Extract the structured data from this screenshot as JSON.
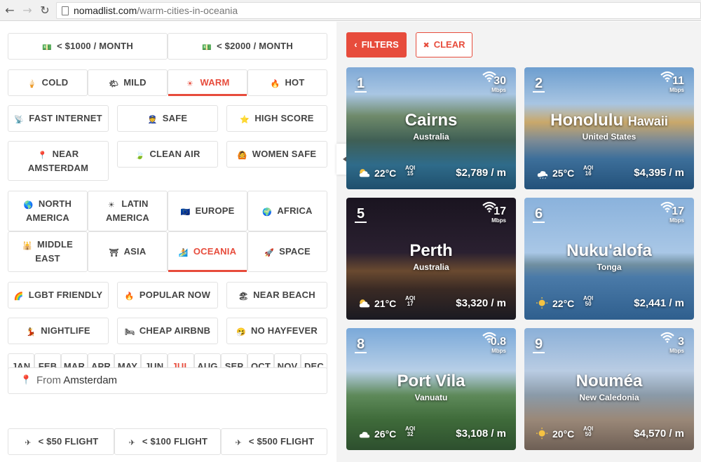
{
  "browser": {
    "domain": "nomadlist.com",
    "path": "/warm-cities-in-oceania",
    "back": "←",
    "forward": "→",
    "reload": "↻"
  },
  "budget": [
    {
      "label": "< $1000 / MONTH",
      "icon": "💵"
    },
    {
      "label": "< $2000 / MONTH",
      "icon": "💵"
    }
  ],
  "climate": [
    {
      "label": "COLD",
      "icon": "🍦"
    },
    {
      "label": "MILD",
      "icon": "🌤"
    },
    {
      "label": "WARM",
      "icon": "☀"
    },
    {
      "label": "HOT",
      "icon": "🔥"
    }
  ],
  "features1": [
    {
      "label": "FAST INTERNET",
      "icon": "📡"
    },
    {
      "label": "SAFE",
      "icon": "👮"
    },
    {
      "label": "HIGH SCORE",
      "icon": "⭐"
    }
  ],
  "features2": [
    {
      "label": "NEAR AMSTERDAM",
      "icon": "📍"
    },
    {
      "label": "CLEAN AIR",
      "icon": "🍃"
    },
    {
      "label": "WOMEN SAFE",
      "icon": "🙆"
    }
  ],
  "regions": [
    {
      "label": "NORTH AMERICA",
      "icon": "🌎"
    },
    {
      "label": "LATIN AMERICA",
      "icon": "☀"
    },
    {
      "label": "EUROPE",
      "icon": "🇪🇺"
    },
    {
      "label": "AFRICA",
      "icon": "🌍"
    },
    {
      "label": "MIDDLE EAST",
      "icon": "🕌"
    },
    {
      "label": "ASIA",
      "icon": "⛩"
    },
    {
      "label": "OCEANIA",
      "icon": "🏄"
    },
    {
      "label": "SPACE",
      "icon": "🚀"
    }
  ],
  "features3": [
    {
      "label": "LGBT FRIENDLY",
      "icon": "🌈"
    },
    {
      "label": "POPULAR NOW",
      "icon": "🔥"
    },
    {
      "label": "NEAR BEACH",
      "icon": "🏖"
    }
  ],
  "features4": [
    {
      "label": "NIGHTLIFE",
      "icon": "💃"
    },
    {
      "label": "CHEAP AIRBNB",
      "icon": "🛏"
    },
    {
      "label": "NO HAYFEVER",
      "icon": "🤧"
    }
  ],
  "months": [
    "JAN",
    "FEB",
    "MAR",
    "APR",
    "MAY",
    "JUN",
    "JUL",
    "AUG",
    "SEP",
    "OCT",
    "NOV",
    "DEC"
  ],
  "from": {
    "label": "From",
    "value": "Amsterdam",
    "icon": "📍"
  },
  "flights": [
    {
      "label": "< $50 FLIGHT",
      "icon": "✈"
    },
    {
      "label": "< $100 FLIGHT",
      "icon": "✈"
    },
    {
      "label": "< $500 FLIGHT",
      "icon": "✈"
    }
  ],
  "actions": {
    "filters": "FILTERS",
    "clear": "CLEAR",
    "filters_icon": "‹",
    "clear_icon": "✖"
  },
  "accent_color": "#e74c3c",
  "cards": [
    {
      "rank": "1",
      "mbps": "30",
      "mbps_label": "Mbps",
      "name": "Cairns",
      "name_sub": "",
      "country": "Australia",
      "temp": "22°C",
      "aqi_label": "AQI",
      "aqi": "15",
      "cost": "$2,789 / m",
      "weather": "partly-cloudy"
    },
    {
      "rank": "2",
      "mbps": "11",
      "mbps_label": "Mbps",
      "name": "Honolulu",
      "name_sub": "Hawaii",
      "country": "United States",
      "temp": "25°C",
      "aqi_label": "AQI",
      "aqi": "16",
      "cost": "$4,395 / m",
      "weather": "rain"
    },
    {
      "rank": "5",
      "mbps": "17",
      "mbps_label": "Mbps",
      "name": "Perth",
      "name_sub": "",
      "country": "Australia",
      "temp": "21°C",
      "aqi_label": "AQI",
      "aqi": "17",
      "cost": "$3,320 / m",
      "weather": "partly-cloudy"
    },
    {
      "rank": "6",
      "mbps": "17",
      "mbps_label": "Mbps",
      "name": "Nuku'alofa",
      "name_sub": "",
      "country": "Tonga",
      "temp": "22°C",
      "aqi_label": "AQI",
      "aqi": "50",
      "cost": "$2,441 / m",
      "weather": "sunny"
    },
    {
      "rank": "8",
      "mbps": "0.8",
      "mbps_label": "Mbps",
      "name": "Port Vila",
      "name_sub": "",
      "country": "Vanuatu",
      "temp": "26°C",
      "aqi_label": "AQI",
      "aqi": "32",
      "cost": "$3,108 / m",
      "weather": "cloudy"
    },
    {
      "rank": "9",
      "mbps": "3",
      "mbps_label": "Mbps",
      "name": "Nouméa",
      "name_sub": "",
      "country": "New Caledonia",
      "temp": "20°C",
      "aqi_label": "AQI",
      "aqi": "50",
      "cost": "$4,570 / m",
      "weather": "sunny"
    }
  ]
}
